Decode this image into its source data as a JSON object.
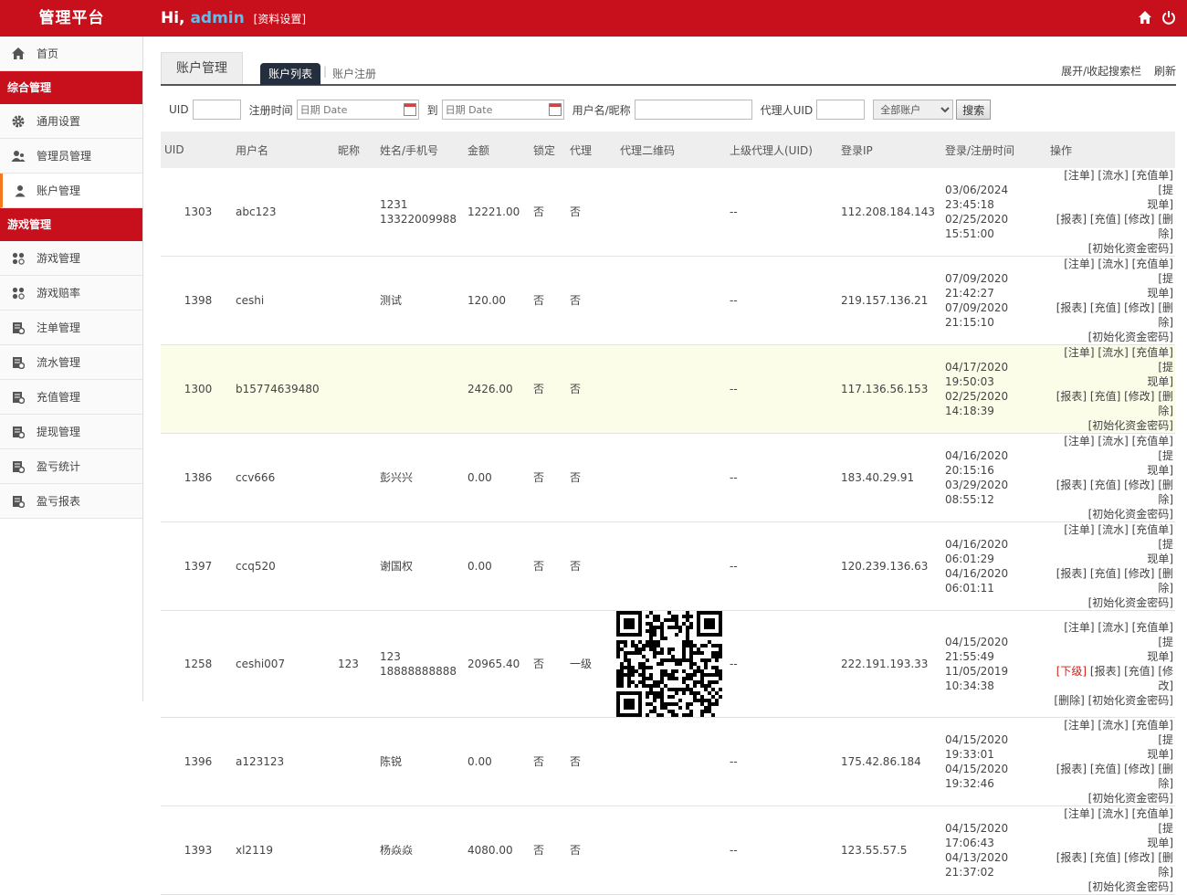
{
  "header": {
    "brand": "管理平台",
    "greeting_hi": "Hi,",
    "username": "admin",
    "profile_link": "[资料设置]",
    "home_icon": "home-icon",
    "power_icon": "power-icon"
  },
  "sidebar": {
    "top_items": [
      {
        "label": "首页",
        "icon": "home-icon"
      }
    ],
    "section1": "综合管理",
    "section1_items": [
      {
        "label": "通用设置",
        "icon": "gear-icon"
      },
      {
        "label": "管理员管理",
        "icon": "users-icon"
      },
      {
        "label": "账户管理",
        "icon": "user-icon"
      }
    ],
    "section2": "游戏管理",
    "section2_items": [
      {
        "label": "游戏管理",
        "icon": "grid-icon"
      },
      {
        "label": "游戏赔率",
        "icon": "grid-icon"
      },
      {
        "label": "注单管理",
        "icon": "report-icon"
      },
      {
        "label": "流水管理",
        "icon": "report-icon"
      },
      {
        "label": "充值管理",
        "icon": "report-icon"
      },
      {
        "label": "提现管理",
        "icon": "report-icon"
      },
      {
        "label": "盈亏统计",
        "icon": "report-icon"
      },
      {
        "label": "盈亏报表",
        "icon": "report-icon"
      }
    ]
  },
  "main": {
    "page_tab": "账户管理",
    "sub_tab_active": "账户列表",
    "sub_tab_other": "账户注册",
    "sub_tab_sep": "|",
    "toggle_search": "展开/收起搜索栏",
    "refresh": "刷新"
  },
  "filters": {
    "uid_label": "UID",
    "reg_time_label": "注册时间",
    "date_placeholder": "日期 Date",
    "to_label": "到",
    "username_label": "用户名/昵称",
    "agent_uid_label": "代理人UID",
    "account_select": "全部账户",
    "search_btn": "搜索"
  },
  "table": {
    "headers": [
      "UID",
      "用户名",
      "昵称",
      "姓名/手机号",
      "金额",
      "锁定",
      "代理",
      "代理二维码",
      "上级代理人(UID)",
      "登录IP",
      "登录/注册时间",
      "操作"
    ],
    "rows": [
      {
        "uid": "1303",
        "username": "abc123",
        "nickname": "",
        "name": "1231",
        "phone": "13322009988",
        "amount": "12221.00",
        "locked": "否",
        "agent": "否",
        "parent": "--",
        "ip": "112.208.184.143",
        "login": "03/06/2024 23:45:18",
        "reg": "02/25/2020 15:51:00"
      },
      {
        "uid": "1398",
        "username": "ceshi",
        "nickname": "",
        "name": "测试",
        "phone": "",
        "amount": "120.00",
        "locked": "否",
        "agent": "否",
        "parent": "--",
        "ip": "219.157.136.21",
        "login": "07/09/2020 21:42:27",
        "reg": "07/09/2020 21:15:10"
      },
      {
        "uid": "1300",
        "username": "b15774639480",
        "nickname": "",
        "name": "",
        "phone": "",
        "amount": "2426.00",
        "locked": "否",
        "agent": "否",
        "parent": "--",
        "ip": "117.136.56.153",
        "login": "04/17/2020 19:50:03",
        "reg": "02/25/2020 14:18:39"
      },
      {
        "uid": "1386",
        "username": "ccv666",
        "nickname": "",
        "name": "彭兴兴",
        "phone": "",
        "amount": "0.00",
        "locked": "否",
        "agent": "否",
        "parent": "--",
        "ip": "183.40.29.91",
        "login": "04/16/2020 20:15:16",
        "reg": "03/29/2020 08:55:12"
      },
      {
        "uid": "1397",
        "username": "ccq520",
        "nickname": "",
        "name": "谢国权",
        "phone": "",
        "amount": "0.00",
        "locked": "否",
        "agent": "否",
        "parent": "--",
        "ip": "120.239.136.63",
        "login": "04/16/2020 06:01:29",
        "reg": "04/16/2020 06:01:11"
      },
      {
        "uid": "1258",
        "username": "ceshi007",
        "nickname": "123",
        "name": "123",
        "phone": "18888888888",
        "amount": "20965.40",
        "locked": "否",
        "agent": "一级",
        "parent": "--",
        "ip": "222.191.193.33",
        "login": "04/15/2020 21:55:49",
        "reg": "11/05/2019 10:34:38"
      },
      {
        "uid": "1396",
        "username": "a123123",
        "nickname": "",
        "name": "陈锐",
        "phone": "",
        "amount": "0.00",
        "locked": "否",
        "agent": "否",
        "parent": "--",
        "ip": "175.42.86.184",
        "login": "04/15/2020 19:33:01",
        "reg": "04/15/2020 19:32:46"
      },
      {
        "uid": "1393",
        "username": "xl2119",
        "nickname": "",
        "name": "杨焱焱",
        "phone": "",
        "amount": "4080.00",
        "locked": "否",
        "agent": "否",
        "parent": "--",
        "ip": "123.55.57.5",
        "login": "04/15/2020 17:06:43",
        "reg": "04/13/2020 21:37:02"
      }
    ],
    "ops": {
      "bet": "[注单]",
      "flow": "[流水]",
      "recharge_order": "[充值单]",
      "withdraw_a": "[提",
      "withdraw_b": "现单]",
      "report": "[报表]",
      "recharge": "[充值]",
      "edit": "[修改]",
      "delete": "[删除]",
      "init_pwd": "[初始化资金密码]",
      "sub": "[下级]"
    }
  }
}
